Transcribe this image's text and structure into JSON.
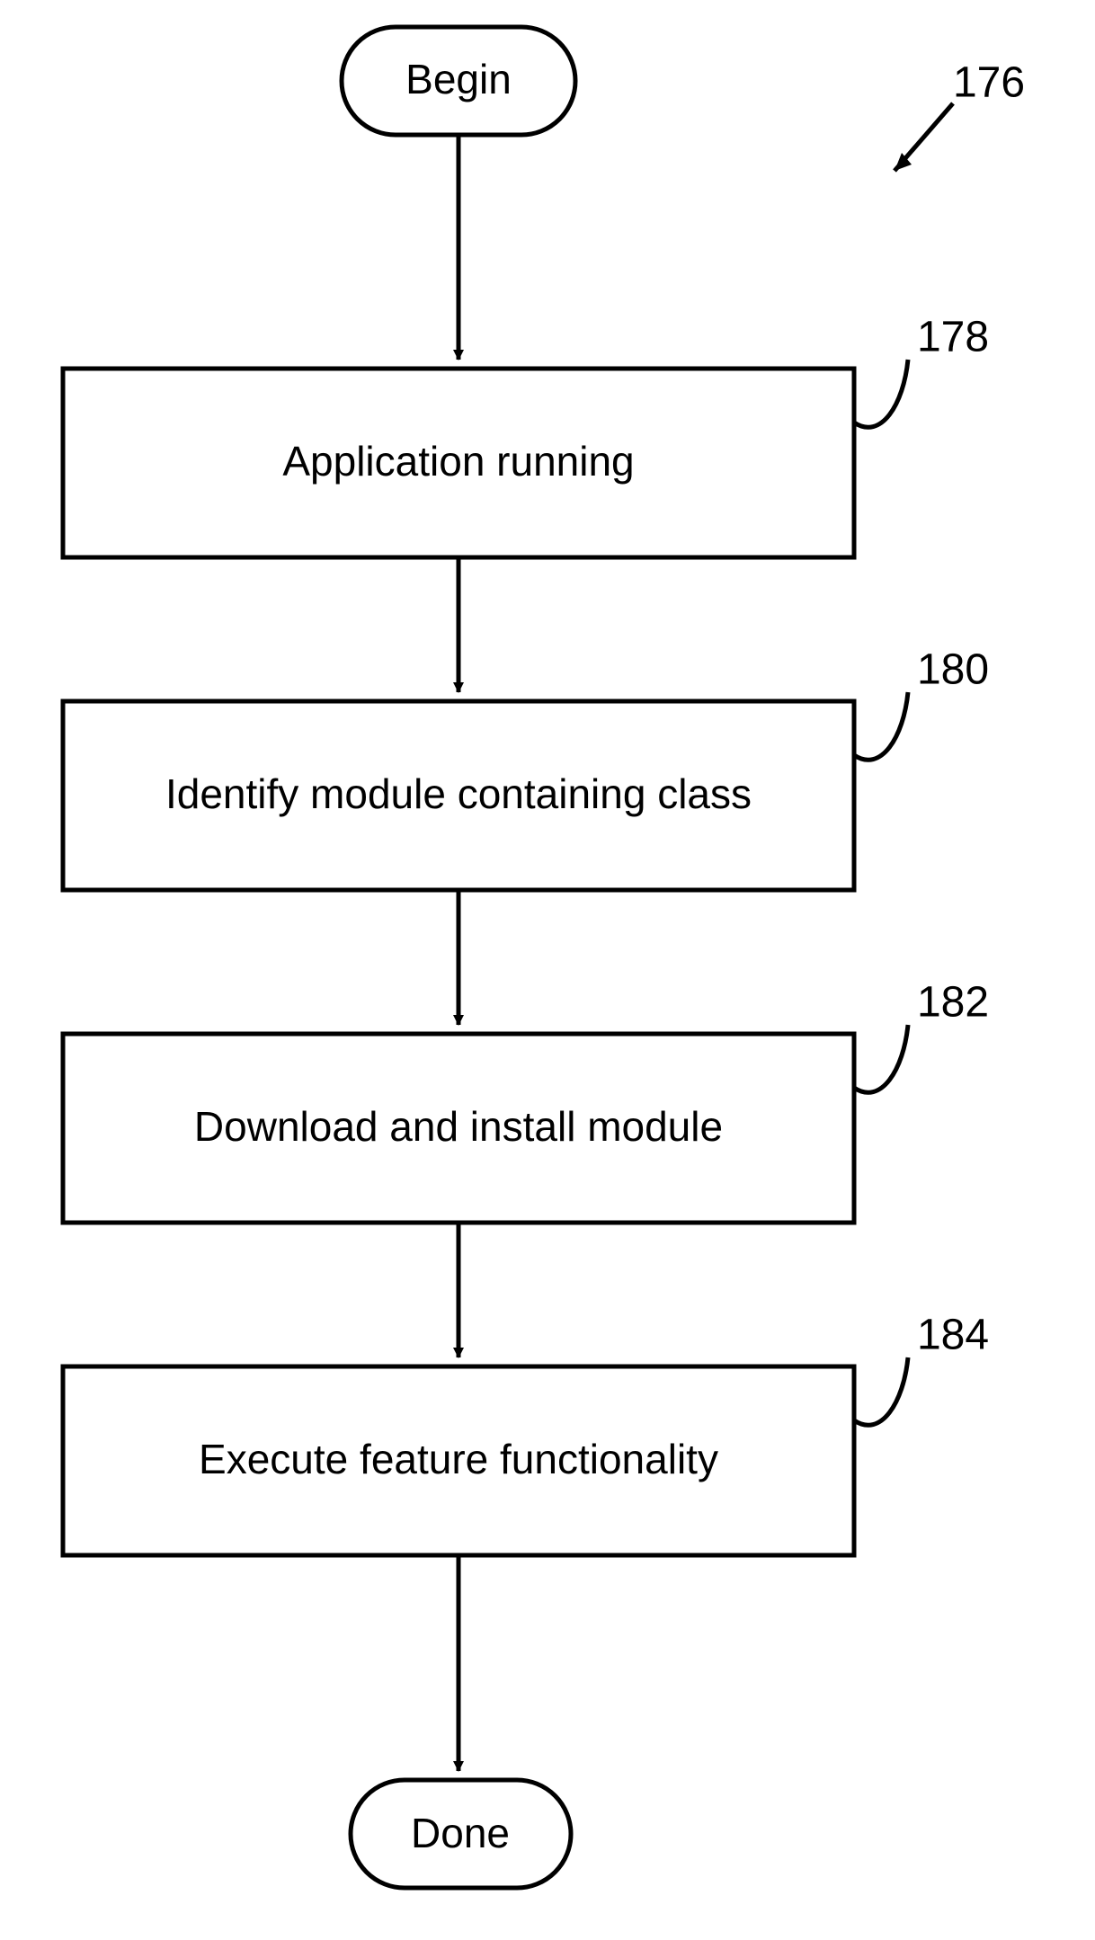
{
  "flow": {
    "begin": "Begin",
    "step1": {
      "text": "Application running",
      "label": "178"
    },
    "step2": {
      "text": "Identify module containing class",
      "label": "180"
    },
    "step3": {
      "text": "Download and install module",
      "label": "182"
    },
    "step4": {
      "text": "Execute feature functionality",
      "label": "184"
    },
    "done": "Done",
    "figure_label": "176"
  }
}
